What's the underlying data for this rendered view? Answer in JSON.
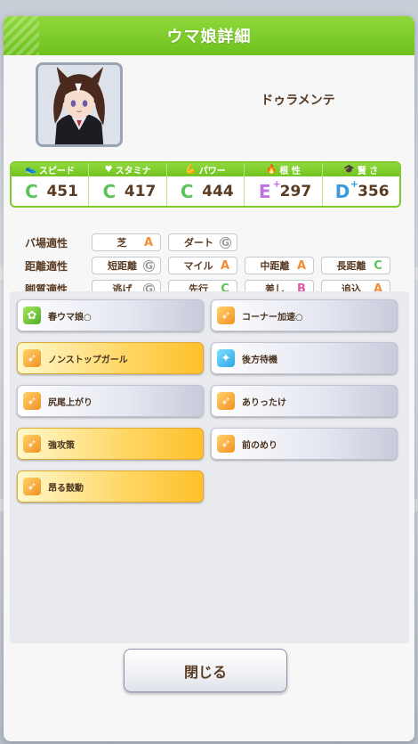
{
  "dialog": {
    "title": "ウマ娘詳細",
    "close_label": "閉じる"
  },
  "character": {
    "name": "ドゥラメンテ"
  },
  "stats": [
    {
      "label": "スピード",
      "icon": "shoe-icon",
      "icon_glyph": "👟",
      "grade": "C",
      "grade_plus": "",
      "grade_color": "#5cc35a",
      "value": "451"
    },
    {
      "label": "スタミナ",
      "icon": "heart-icon",
      "icon_glyph": "♥",
      "grade": "C",
      "grade_plus": "",
      "grade_color": "#5cc35a",
      "value": "417"
    },
    {
      "label": "パワー",
      "icon": "arm-icon",
      "icon_glyph": "💪",
      "grade": "C",
      "grade_plus": "",
      "grade_color": "#5cc35a",
      "value": "444"
    },
    {
      "label": "根 性",
      "icon": "flame-icon",
      "icon_glyph": "🔥",
      "grade": "E",
      "grade_plus": "+",
      "grade_color": "#c070e0",
      "value": "297"
    },
    {
      "label": "賢 さ",
      "icon": "graduation-cap-icon",
      "icon_glyph": "🎓",
      "grade": "D",
      "grade_plus": "+",
      "grade_color": "#3a9ae0",
      "value": "356"
    }
  ],
  "aptitude": {
    "track": {
      "label": "バ場適性",
      "items": [
        {
          "name": "芝",
          "grade": "A"
        },
        {
          "name": "ダート",
          "grade": "G"
        }
      ]
    },
    "distance": {
      "label": "距離適性",
      "items": [
        {
          "name": "短距離",
          "grade": "G"
        },
        {
          "name": "マイル",
          "grade": "A"
        },
        {
          "name": "中距離",
          "grade": "A"
        },
        {
          "name": "長距離",
          "grade": "C"
        }
      ]
    },
    "style": {
      "label": "脚質適性",
      "items": [
        {
          "name": "逃げ",
          "grade": "G"
        },
        {
          "name": "先行",
          "grade": "C"
        },
        {
          "name": "差し",
          "grade": "B"
        },
        {
          "name": "追込",
          "grade": "A"
        }
      ]
    }
  },
  "skills": [
    {
      "name": "春ウマ娘○",
      "style": "white",
      "icon": "green"
    },
    {
      "name": "コーナー加速○",
      "style": "white",
      "icon": "orange"
    },
    {
      "name": "ノンストップガール",
      "style": "gold",
      "icon": "orange"
    },
    {
      "name": "後方待機",
      "style": "white",
      "icon": "blue"
    },
    {
      "name": "尻尾上がり",
      "style": "white",
      "icon": "orange"
    },
    {
      "name": "ありったけ",
      "style": "white",
      "icon": "orange"
    },
    {
      "name": "強攻策",
      "style": "gold",
      "icon": "orange"
    },
    {
      "name": "前のめり",
      "style": "white",
      "icon": "orange"
    },
    {
      "name": "昂る鼓動",
      "style": "gold",
      "icon": "orange"
    }
  ]
}
